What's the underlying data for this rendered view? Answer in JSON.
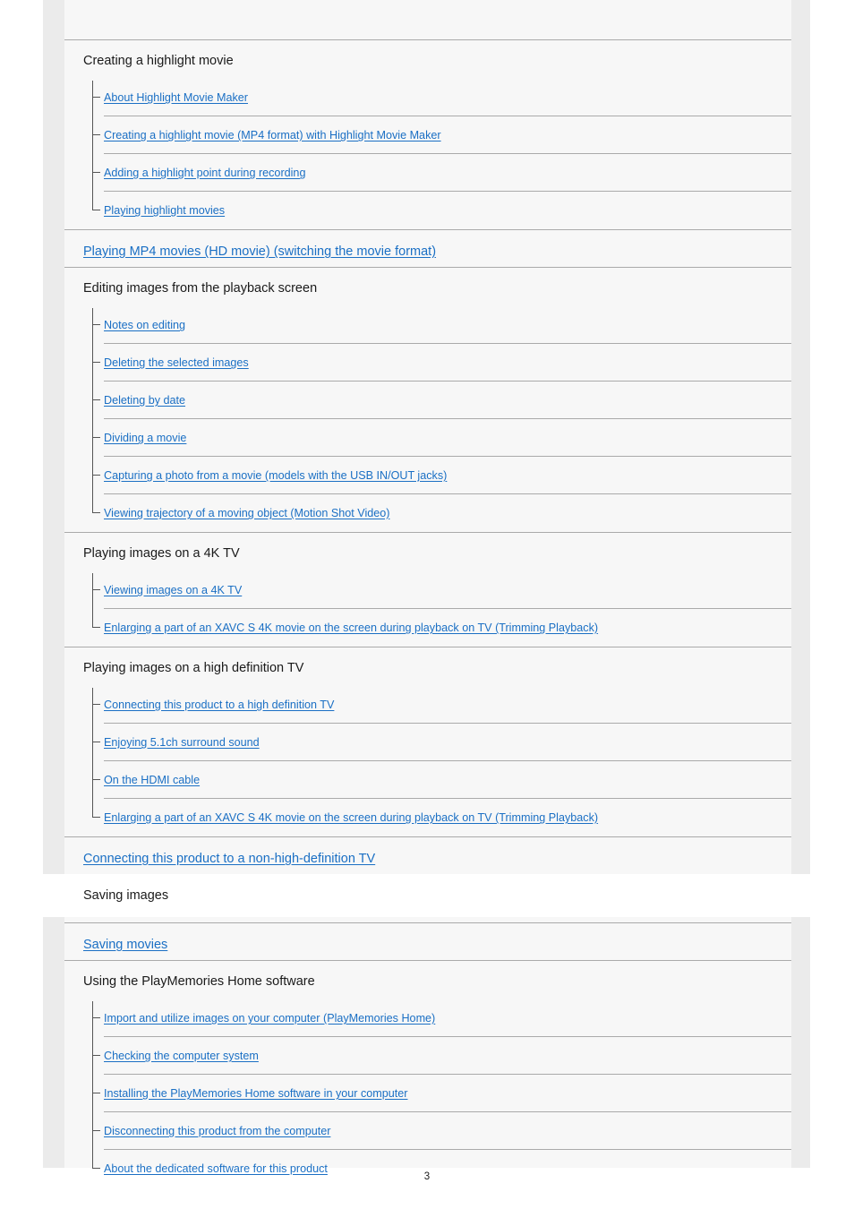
{
  "page": {
    "number": "3",
    "accent_link_color": "#1a6fc4",
    "heading_color": "#1a1a1a",
    "band_color": "#ebebeb",
    "content_color": "#f7f7f7",
    "section_band_color": "#ffffff",
    "rule_color": "#aaaaaa"
  },
  "toc": {
    "groups": [
      {
        "type": "group",
        "heading": "Creating a highlight movie",
        "items": [
          "About Highlight Movie Maker",
          "Creating a highlight movie (MP4 format) with Highlight Movie Maker",
          "Adding a highlight point during recording",
          "Playing highlight movies"
        ]
      },
      {
        "type": "link",
        "label": "Playing MP4 movies (HD movie) (switching the movie format)"
      },
      {
        "type": "group",
        "heading": "Editing images from the playback screen",
        "items": [
          "Notes on editing",
          "Deleting the selected images",
          "Deleting by date",
          "Dividing a movie",
          "Capturing a photo from a movie (models with the USB IN/OUT jacks)",
          "Viewing trajectory of a moving object (Motion Shot Video)"
        ]
      },
      {
        "type": "group",
        "heading": "Playing images on a 4K TV",
        "items": [
          "Viewing images on a 4K TV",
          "Enlarging a part of an XAVC S 4K movie on the screen during playback on TV (Trimming Playback)"
        ]
      },
      {
        "type": "group",
        "heading": "Playing images on a high definition TV",
        "items": [
          "Connecting this product to a high definition TV",
          "Enjoying 5.1ch surround sound",
          "On the HDMI cable",
          "Enlarging a part of an XAVC S 4K movie on the screen during playback on TV (Trimming Playback)"
        ]
      },
      {
        "type": "link",
        "label": "Connecting this product to a non-high-definition TV"
      },
      {
        "type": "section",
        "label": "Saving images"
      },
      {
        "type": "link",
        "label": "Saving movies"
      },
      {
        "type": "group",
        "heading": "Using the PlayMemories Home software",
        "items": [
          "Import and utilize images on your computer (PlayMemories Home)",
          "Checking the computer system",
          "Installing the PlayMemories Home software in your computer",
          "Disconnecting this product from the computer",
          "About the dedicated software for this product"
        ]
      }
    ]
  }
}
